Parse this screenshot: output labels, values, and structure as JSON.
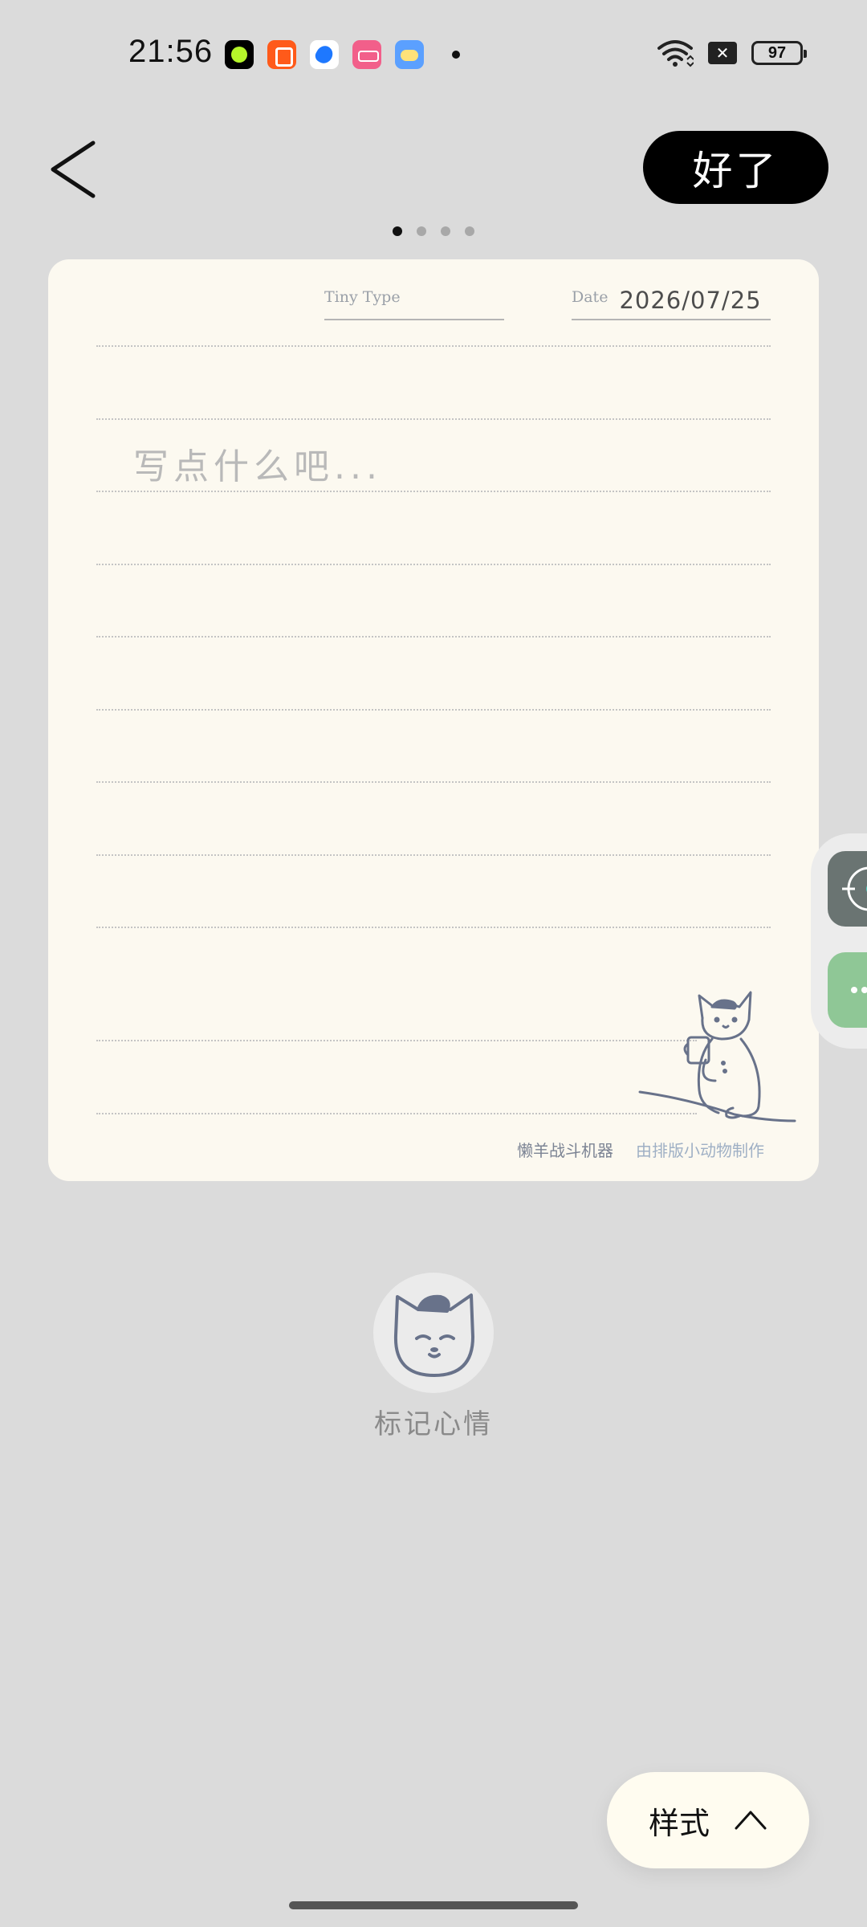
{
  "status_bar": {
    "time": "21:56",
    "battery": "97",
    "notification_icons": [
      "app-icon",
      "video-app-icon",
      "browser-icon",
      "bilibili-icon",
      "weather-icon"
    ]
  },
  "header": {
    "done_label": "好了"
  },
  "pager": {
    "total": 4,
    "active_index": 0
  },
  "note": {
    "type_label": "Tiny Type",
    "date_label": "Date",
    "date_value": "2026/07/25",
    "placeholder": "写点什么吧...",
    "author": "懒羊战斗机器",
    "credit": "由排版小动物制作"
  },
  "mood": {
    "label": "标记心情"
  },
  "style_button": {
    "label": "样式"
  },
  "colors": {
    "background": "#dbdbdb",
    "card": "#fcf9f0",
    "done_button": "#000000",
    "side_button_1": "#6a7472",
    "side_button_2": "#8fc796"
  }
}
